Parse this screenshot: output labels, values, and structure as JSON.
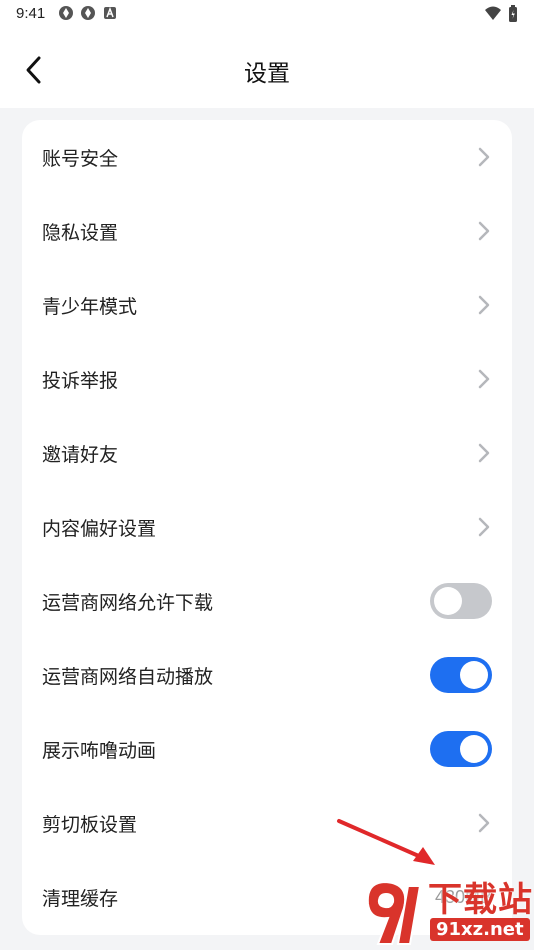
{
  "status_bar": {
    "time": "9:41"
  },
  "header": {
    "title": "设置"
  },
  "settings": [
    {
      "label": "账号安全",
      "control": "chevron"
    },
    {
      "label": "隐私设置",
      "control": "chevron"
    },
    {
      "label": "青少年模式",
      "control": "chevron"
    },
    {
      "label": "投诉举报",
      "control": "chevron"
    },
    {
      "label": "邀请好友",
      "control": "chevron"
    },
    {
      "label": "内容偏好设置",
      "control": "chevron"
    },
    {
      "label": "运营商网络允许下载",
      "control": "toggle",
      "enabled": false
    },
    {
      "label": "运营商网络自动播放",
      "control": "toggle",
      "enabled": true
    },
    {
      "label": "展示咘噜动画",
      "control": "toggle",
      "enabled": true
    },
    {
      "label": "剪切板设置",
      "control": "chevron"
    },
    {
      "label": "清理缓存",
      "control": "value",
      "value": "430MB"
    }
  ],
  "watermark": {
    "text": "下载站",
    "url": "91xz.net"
  },
  "colors": {
    "accent": "#1e6ff1",
    "toggle_off": "#c6c8cc",
    "annotation_arrow": "#e0282a"
  }
}
